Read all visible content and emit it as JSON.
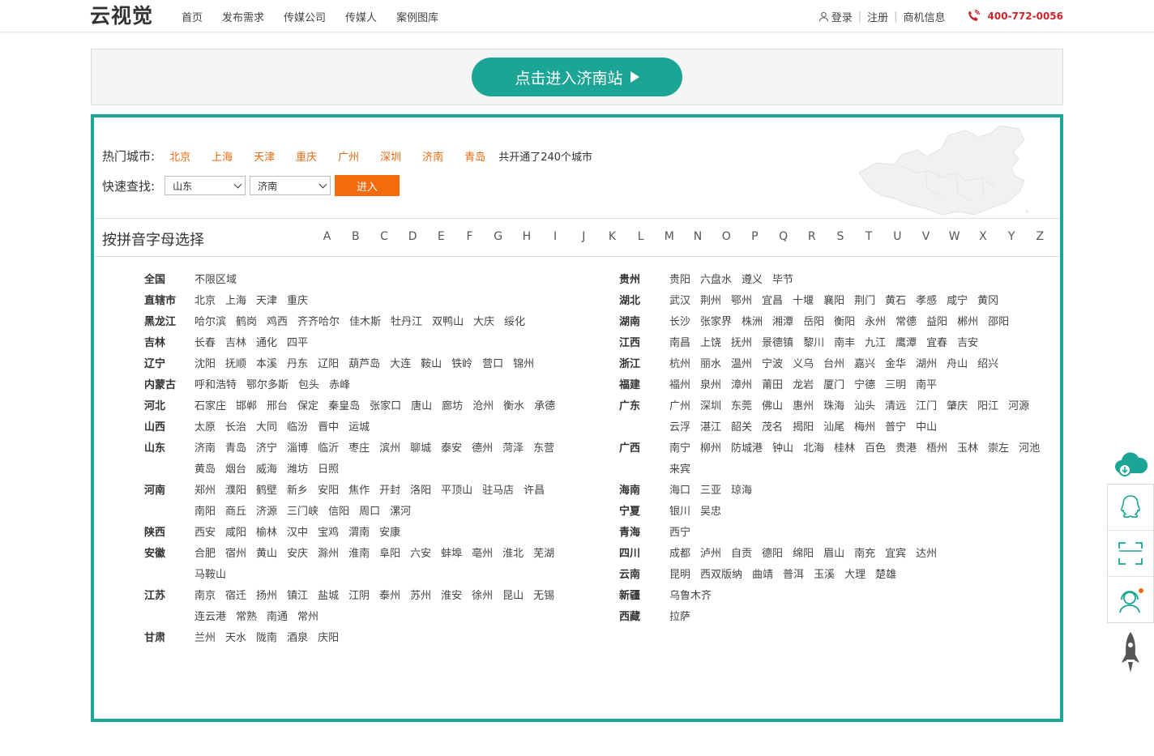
{
  "header": {
    "logo_text": "云视觉",
    "nav": [
      "首页",
      "发布需求",
      "传媒公司",
      "传媒人",
      "案例图库"
    ],
    "login": "登录",
    "register": "注册",
    "business": "商机信息",
    "phone": "400-772-0056"
  },
  "banner": {
    "button_label": "点击进入济南站"
  },
  "hot": {
    "label": "热门城市:",
    "cities": [
      "北京",
      "上海",
      "天津",
      "重庆",
      "广州",
      "深圳",
      "济南",
      "青岛"
    ],
    "note": "共开通了240个城市"
  },
  "quick": {
    "label": "快速查找:",
    "province": "山东",
    "city": "济南",
    "go_label": "进入"
  },
  "pinyin": {
    "title": "按拼音字母选择",
    "letters": [
      "A",
      "B",
      "C",
      "D",
      "E",
      "F",
      "G",
      "H",
      "I",
      "J",
      "K",
      "L",
      "M",
      "N",
      "O",
      "P",
      "Q",
      "R",
      "S",
      "T",
      "U",
      "V",
      "W",
      "X",
      "Y",
      "Z"
    ]
  },
  "provinces_left": [
    {
      "name": "全国",
      "cities": [
        "不限区域"
      ]
    },
    {
      "name": "直辖市",
      "cities": [
        "北京",
        "上海",
        "天津",
        "重庆"
      ]
    },
    {
      "name": "黑龙江",
      "cities": [
        "哈尔滨",
        "鹤岗",
        "鸡西",
        "齐齐哈尔",
        "佳木斯",
        "牡丹江",
        "双鸭山",
        "大庆",
        "绥化"
      ]
    },
    {
      "name": "吉林",
      "cities": [
        "长春",
        "吉林",
        "通化",
        "四平"
      ]
    },
    {
      "name": "辽宁",
      "cities": [
        "沈阳",
        "抚顺",
        "本溪",
        "丹东",
        "辽阳",
        "葫芦岛",
        "大连",
        "鞍山",
        "铁岭",
        "营口",
        "锦州"
      ]
    },
    {
      "name": "内蒙古",
      "cities": [
        "呼和浩特",
        "鄂尔多斯",
        "包头",
        "赤峰"
      ]
    },
    {
      "name": "河北",
      "cities": [
        "石家庄",
        "邯郸",
        "邢台",
        "保定",
        "秦皇岛",
        "张家口",
        "唐山",
        "廊坊",
        "沧州",
        "衡水",
        "承德"
      ]
    },
    {
      "name": "山西",
      "cities": [
        "太原",
        "长治",
        "大同",
        "临汾",
        "晋中",
        "运城"
      ]
    },
    {
      "name": "山东",
      "cities": [
        "济南",
        "青岛",
        "济宁",
        "淄博",
        "临沂",
        "枣庄",
        "滨州",
        "聊城",
        "泰安",
        "德州",
        "菏泽",
        "东营",
        "黄岛",
        "烟台",
        "威海",
        "潍坊",
        "日照"
      ]
    },
    {
      "name": "河南",
      "cities": [
        "郑州",
        "濮阳",
        "鹤壁",
        "新乡",
        "安阳",
        "焦作",
        "开封",
        "洛阳",
        "平顶山",
        "驻马店",
        "许昌",
        "南阳",
        "商丘",
        "济源",
        "三门峡",
        "信阳",
        "周口",
        "漯河"
      ]
    },
    {
      "name": "陕西",
      "cities": [
        "西安",
        "咸阳",
        "榆林",
        "汉中",
        "宝鸡",
        "渭南",
        "安康"
      ]
    },
    {
      "name": "安徽",
      "cities": [
        "合肥",
        "宿州",
        "黄山",
        "安庆",
        "滁州",
        "淮南",
        "阜阳",
        "六安",
        "蚌埠",
        "亳州",
        "淮北",
        "芜湖",
        "马鞍山"
      ]
    },
    {
      "name": "江苏",
      "cities": [
        "南京",
        "宿迁",
        "扬州",
        "镇江",
        "盐城",
        "江阴",
        "泰州",
        "苏州",
        "淮安",
        "徐州",
        "昆山",
        "无锡",
        "连云港",
        "常熟",
        "南通",
        "常州"
      ]
    },
    {
      "name": "甘肃",
      "cities": [
        "兰州",
        "天水",
        "陇南",
        "酒泉",
        "庆阳"
      ]
    }
  ],
  "provinces_right": [
    {
      "name": "贵州",
      "cities": [
        "贵阳",
        "六盘水",
        "遵义",
        "毕节"
      ]
    },
    {
      "name": "湖北",
      "cities": [
        "武汉",
        "荆州",
        "鄂州",
        "宜昌",
        "十堰",
        "襄阳",
        "荆门",
        "黄石",
        "孝感",
        "咸宁",
        "黄冈"
      ]
    },
    {
      "name": "湖南",
      "cities": [
        "长沙",
        "张家界",
        "株洲",
        "湘潭",
        "岳阳",
        "衡阳",
        "永州",
        "常德",
        "益阳",
        "郴州",
        "邵阳"
      ]
    },
    {
      "name": "江西",
      "cities": [
        "南昌",
        "上饶",
        "抚州",
        "景德镇",
        "黎川",
        "南丰",
        "九江",
        "鹰潭",
        "宜春",
        "吉安"
      ]
    },
    {
      "name": "浙江",
      "cities": [
        "杭州",
        "丽水",
        "温州",
        "宁波",
        "义乌",
        "台州",
        "嘉兴",
        "金华",
        "湖州",
        "舟山",
        "绍兴"
      ]
    },
    {
      "name": "福建",
      "cities": [
        "福州",
        "泉州",
        "漳州",
        "莆田",
        "龙岩",
        "厦门",
        "宁德",
        "三明",
        "南平"
      ]
    },
    {
      "name": "广东",
      "cities": [
        "广州",
        "深圳",
        "东莞",
        "佛山",
        "惠州",
        "珠海",
        "汕头",
        "清远",
        "江门",
        "肇庆",
        "阳江",
        "河源",
        "云浮",
        "湛江",
        "韶关",
        "茂名",
        "揭阳",
        "汕尾",
        "梅州",
        "普宁",
        "中山"
      ]
    },
    {
      "name": "广西",
      "cities": [
        "南宁",
        "柳州",
        "防城港",
        "钟山",
        "北海",
        "桂林",
        "百色",
        "贵港",
        "梧州",
        "玉林",
        "崇左",
        "河池",
        "来宾"
      ]
    },
    {
      "name": "海南",
      "cities": [
        "海口",
        "三亚",
        "琼海"
      ]
    },
    {
      "name": "宁夏",
      "cities": [
        "银川",
        "吴忠"
      ]
    },
    {
      "name": "青海",
      "cities": [
        "西宁"
      ]
    },
    {
      "name": "四川",
      "cities": [
        "成都",
        "泸州",
        "自贡",
        "德阳",
        "绵阳",
        "眉山",
        "南充",
        "宜宾",
        "达州"
      ]
    },
    {
      "name": "云南",
      "cities": [
        "昆明",
        "西双版纳",
        "曲靖",
        "普洱",
        "玉溪",
        "大理",
        "楚雄"
      ]
    },
    {
      "name": "新疆",
      "cities": [
        "乌鲁木齐"
      ]
    },
    {
      "name": "西藏",
      "cities": [
        "拉萨"
      ]
    }
  ],
  "colors": {
    "teal": "#1aa594",
    "orange": "#f46b0e",
    "hot_city": "#e86a10",
    "phone_red": "#c8252c"
  }
}
